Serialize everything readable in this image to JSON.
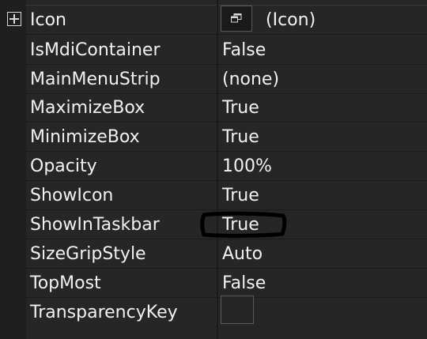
{
  "properties": [
    {
      "name": "Icon",
      "value": "(Icon)",
      "expandable": true,
      "swatch": "icon-image"
    },
    {
      "name": "IsMdiContainer",
      "value": "False"
    },
    {
      "name": "MainMenuStrip",
      "value": "(none)"
    },
    {
      "name": "MaximizeBox",
      "value": "True"
    },
    {
      "name": "MinimizeBox",
      "value": "True"
    },
    {
      "name": "Opacity",
      "value": "100%"
    },
    {
      "name": "ShowIcon",
      "value": "True"
    },
    {
      "name": "ShowInTaskbar",
      "value": "True",
      "annotated": true
    },
    {
      "name": "SizeGripStyle",
      "value": "Auto"
    },
    {
      "name": "TopMost",
      "value": "False"
    },
    {
      "name": "TransparencyKey",
      "value": "",
      "swatch": "color-swatch"
    }
  ],
  "colors": {
    "background": "#1f1f1f",
    "row_background": "#262626",
    "text": "#f1f1f1",
    "annotation_stroke": "#000000"
  },
  "icons": {
    "expand": "plus-square-icon",
    "icon_swatch": "form-icon"
  }
}
